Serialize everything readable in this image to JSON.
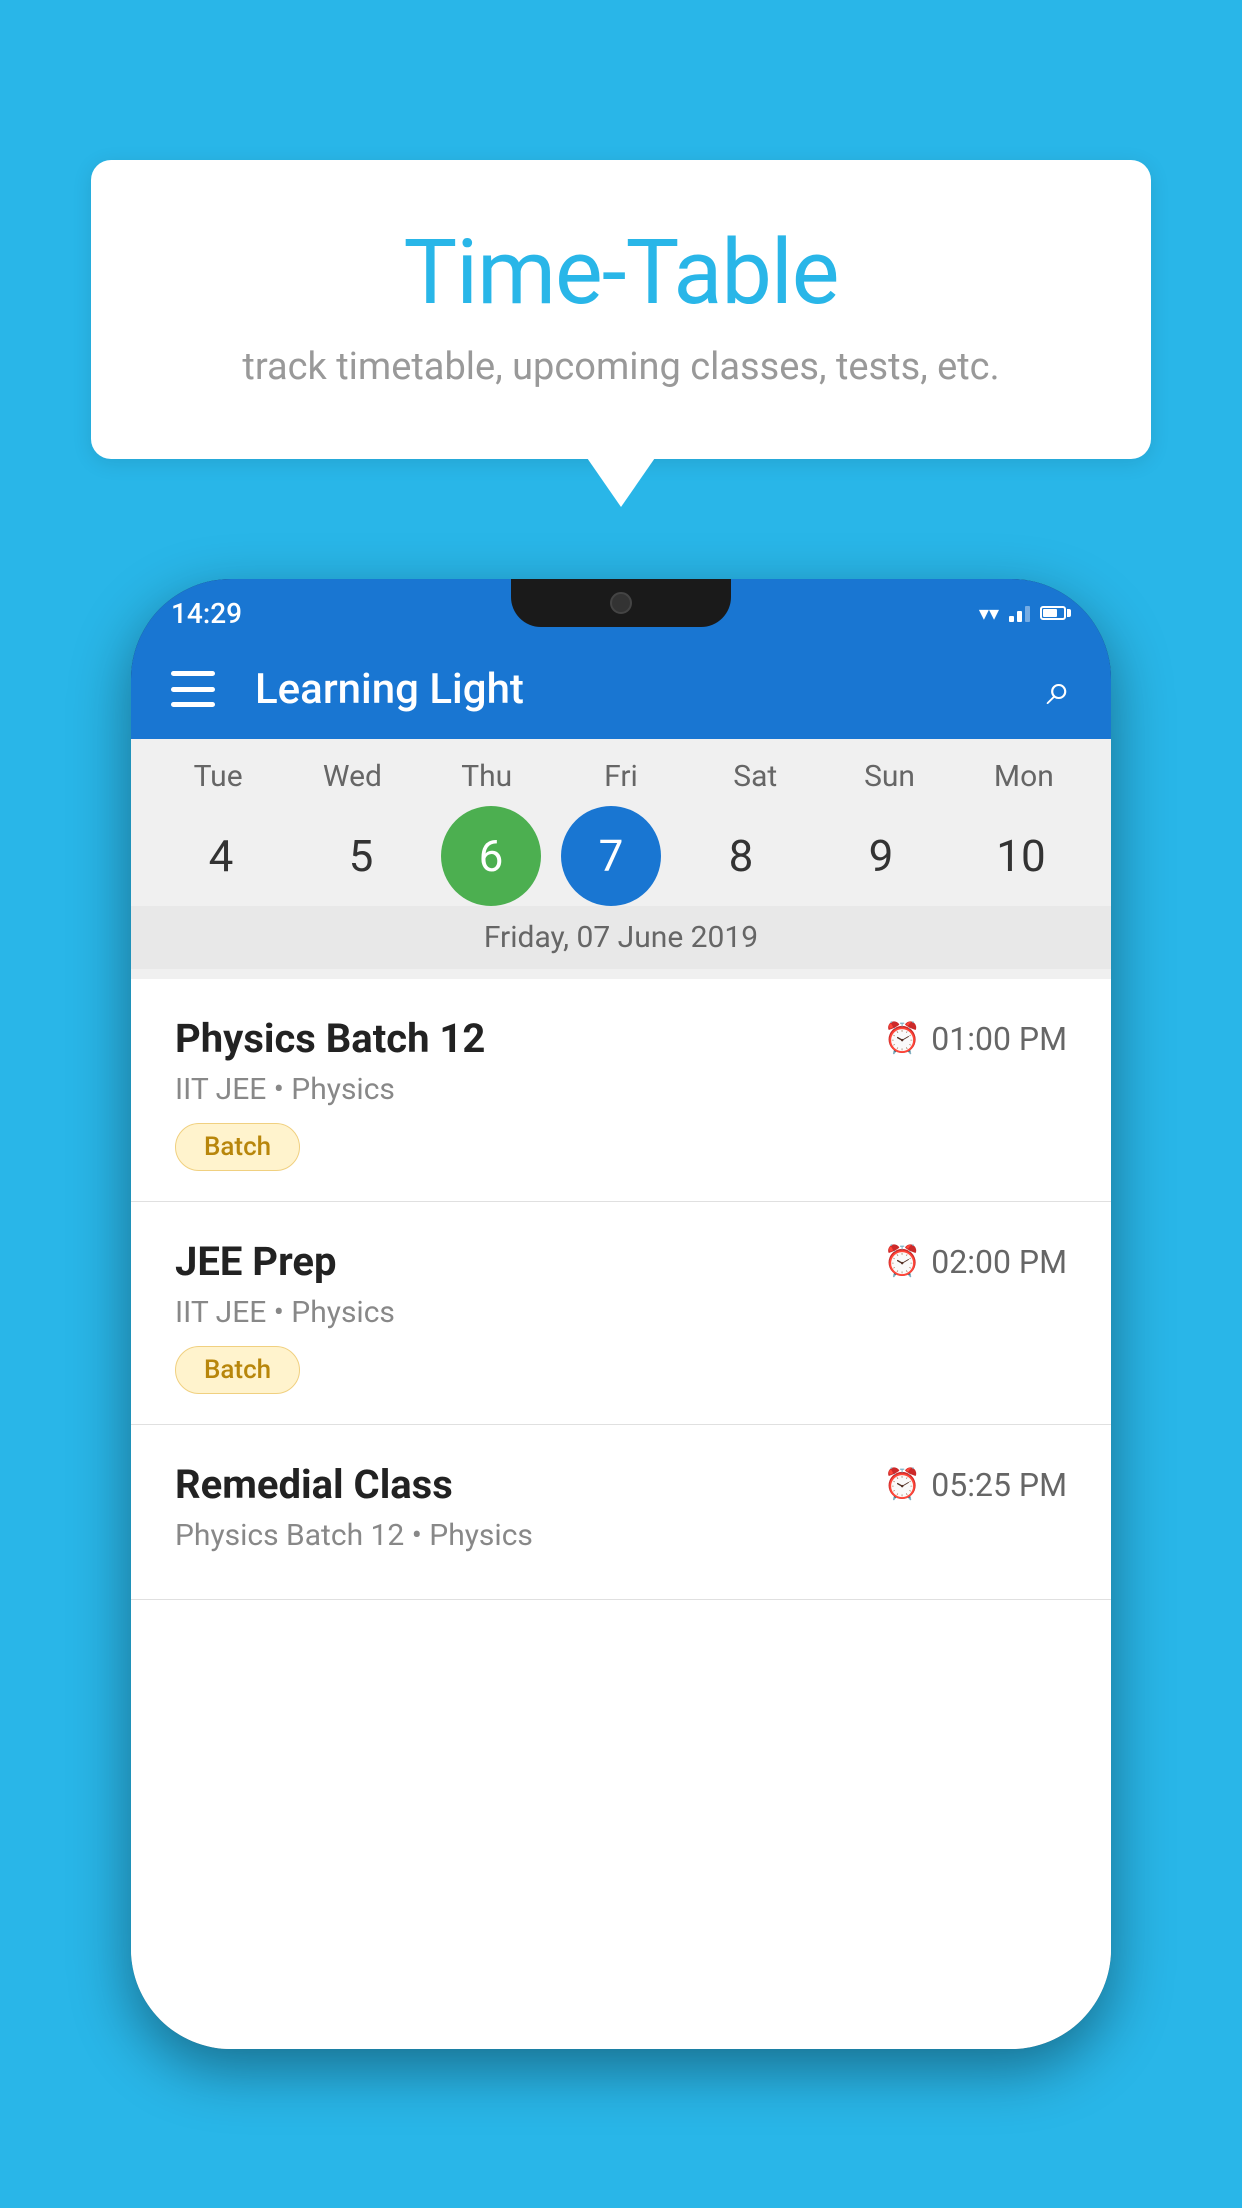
{
  "background_color": "#29B6E8",
  "tooltip": {
    "title": "Time-Table",
    "subtitle": "track timetable, upcoming classes, tests, etc."
  },
  "phone": {
    "status_bar": {
      "time": "14:29"
    },
    "app_bar": {
      "title": "Learning Light"
    },
    "calendar": {
      "days": [
        {
          "label": "Tue",
          "number": "4"
        },
        {
          "label": "Wed",
          "number": "5"
        },
        {
          "label": "Thu",
          "number": "6",
          "state": "today"
        },
        {
          "label": "Fri",
          "number": "7",
          "state": "selected"
        },
        {
          "label": "Sat",
          "number": "8"
        },
        {
          "label": "Sun",
          "number": "9"
        },
        {
          "label": "Mon",
          "number": "10"
        }
      ],
      "selected_date": "Friday, 07 June 2019"
    },
    "classes": [
      {
        "name": "Physics Batch 12",
        "time": "01:00 PM",
        "subject": "IIT JEE • Physics",
        "badge": "Batch"
      },
      {
        "name": "JEE Prep",
        "time": "02:00 PM",
        "subject": "IIT JEE • Physics",
        "badge": "Batch"
      },
      {
        "name": "Remedial Class",
        "time": "05:25 PM",
        "subject": "Physics Batch 12 • Physics",
        "badge": ""
      }
    ]
  }
}
